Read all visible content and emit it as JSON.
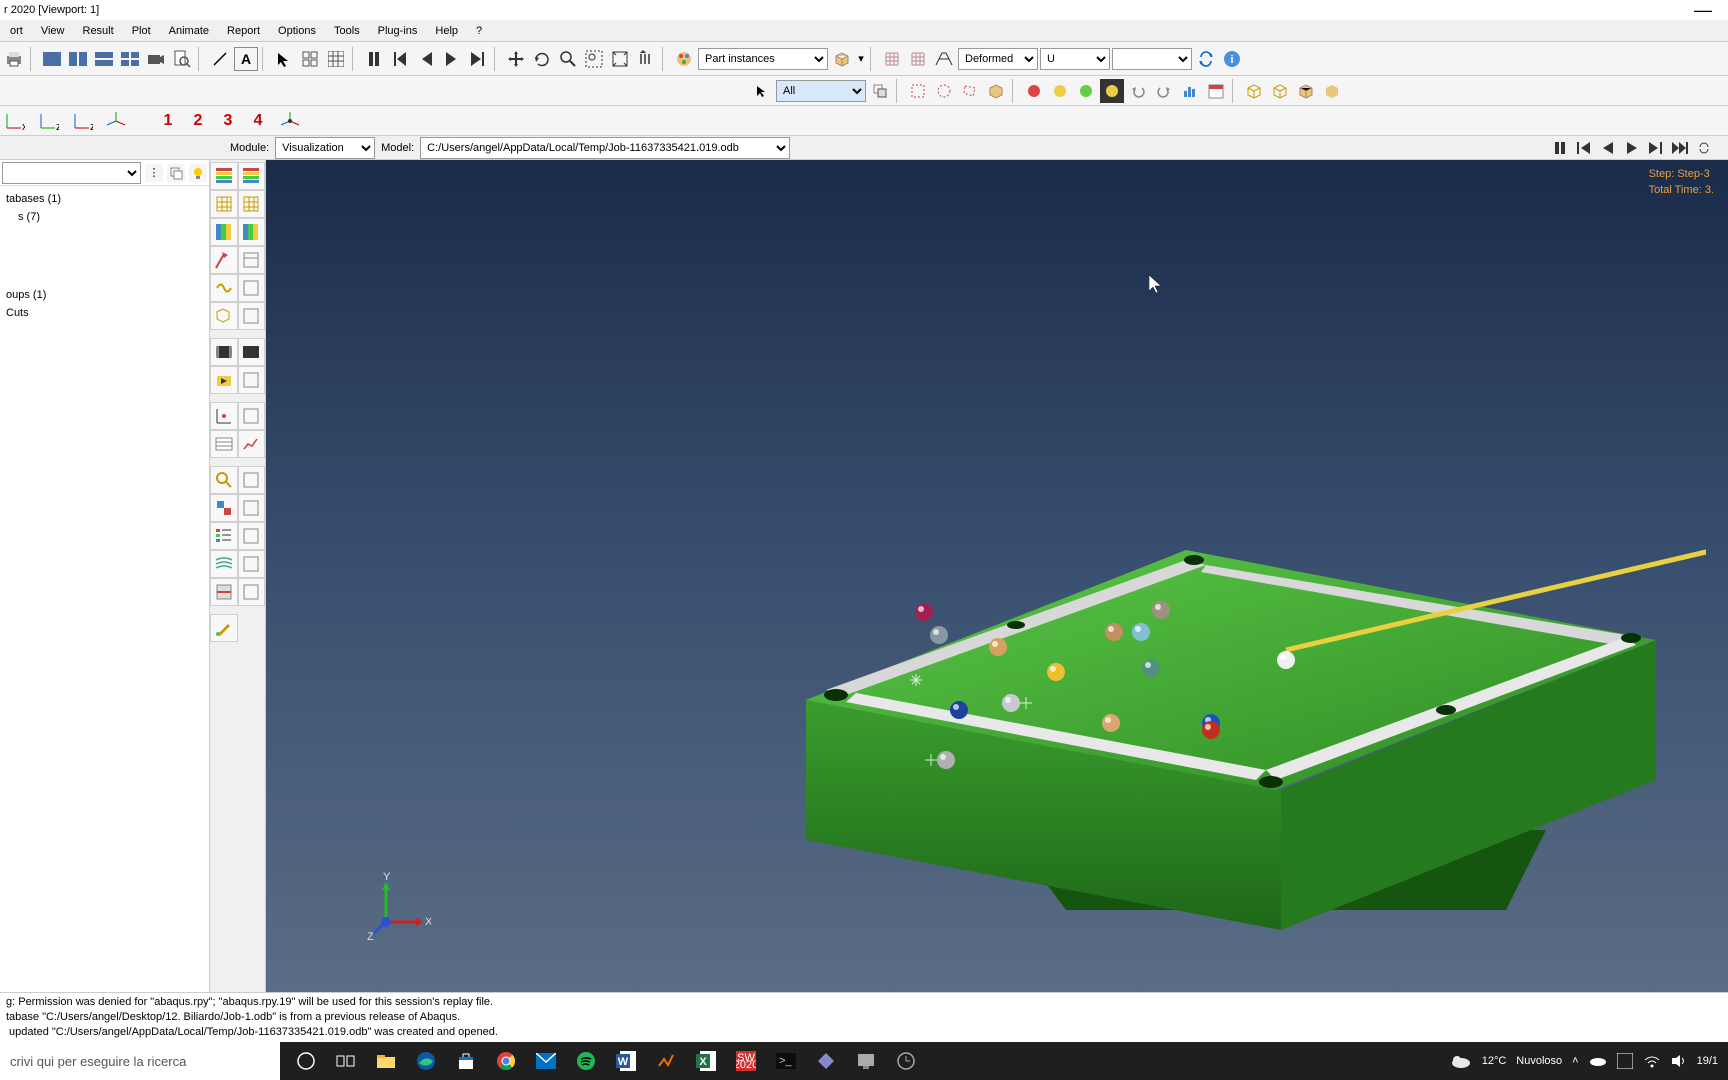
{
  "window": {
    "title": "r 2020 [Viewport: 1]"
  },
  "menu": {
    "items": [
      "ort",
      "View",
      "Result",
      "Plot",
      "Animate",
      "Report",
      "Options",
      "Tools",
      "Plug-ins",
      "Help",
      "?"
    ]
  },
  "toolbar": {
    "part_instances_label": "Part instances",
    "all_label": "All",
    "deformed_label": "Deformed",
    "field_u": "U"
  },
  "context": {
    "module_label": "Module:",
    "module_value": "Visualization",
    "model_label": "Model:",
    "model_value": "C:/Users/angel/AppData/Local/Temp/Job-11637335421.019.odb"
  },
  "viewbar_nums": [
    "1",
    "2",
    "3",
    "4"
  ],
  "tree": {
    "filter_placeholder": "",
    "items": [
      "tabases (1)",
      "s (7)",
      "oups (1)",
      "Cuts"
    ]
  },
  "viewport": {
    "step_line": "Step: Step-3",
    "time_line": "Total Time: 3.",
    "triad_x": "X",
    "triad_y": "Y",
    "triad_z": "Z"
  },
  "console": {
    "line1": "g: Permission was denied for \"abaqus.rpy\"; \"abaqus.rpy.19\" will be used for this session's replay file.",
    "line2": "tabase \"C:/Users/angel/Desktop/12. Biliardo/Job-1.odb\" is from a previous release of Abaqus.",
    "line3": " updated \"C:/Users/angel/AppData/Local/Temp/Job-11637335421.019.odb\" was created and opened."
  },
  "taskbar": {
    "search_placeholder": "crivi qui per eseguire la ricerca",
    "weather_temp": "12°C",
    "weather_desc": "Nuvoloso",
    "date": "19/1"
  },
  "icons": {
    "file": "file-icon",
    "print": "print-icon",
    "pause": "pause-icon",
    "first": "first-icon",
    "prev": "prev-icon",
    "play": "play-icon",
    "next": "next-icon",
    "last": "last-icon"
  }
}
